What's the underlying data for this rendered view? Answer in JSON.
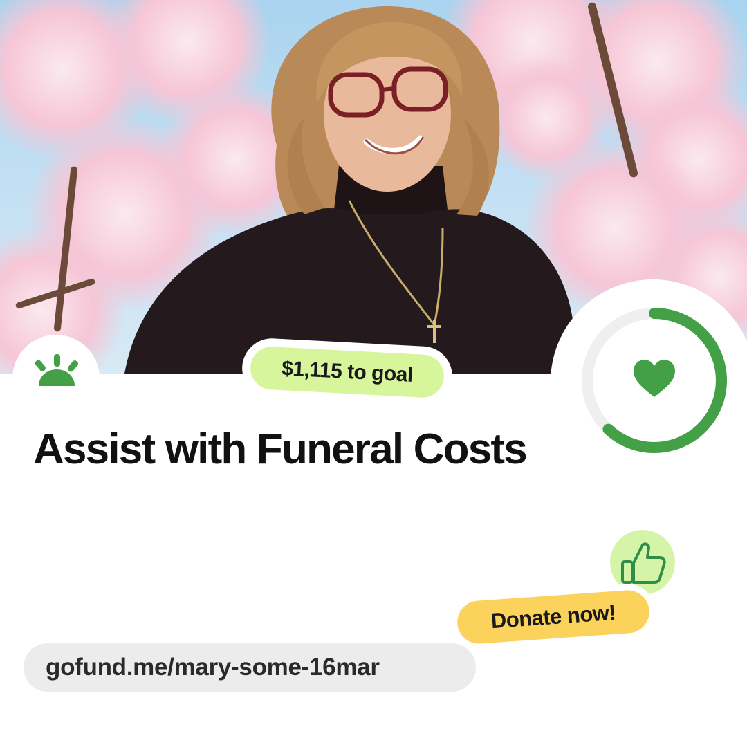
{
  "campaign": {
    "goal_remaining": "$1,115 to goal",
    "title": "Assist with Funeral Costs",
    "donate_label": "Donate now!",
    "url": "gofund.me/mary-some-16mar",
    "progress_fraction": 0.62
  },
  "icons": {
    "logo": "gofundme-sunrise-icon",
    "progress": "heart-icon",
    "reaction": "thumbs-up-icon"
  },
  "colors": {
    "brand_green": "#43a047",
    "goal_pill": "#d7f59a",
    "donate_pill": "#fbd35c",
    "url_pill": "#ececec",
    "thumb_bg": "#d6f4a8"
  }
}
